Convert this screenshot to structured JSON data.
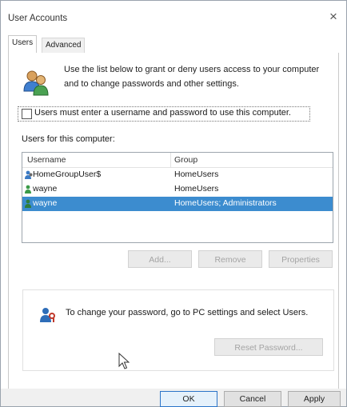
{
  "window": {
    "title": "User Accounts",
    "close_glyph": "×"
  },
  "tabs": [
    {
      "label": "Users",
      "active": true
    },
    {
      "label": "Advanced",
      "active": false
    }
  ],
  "intro": {
    "icon": "users-icon",
    "text": "Use the list below to grant or deny users access to your computer and to change passwords and other settings."
  },
  "require_password": {
    "label": "Users must enter a username and password to use this computer.",
    "checked": false
  },
  "users_list": {
    "caption": "Users for this computer:",
    "columns": [
      "Username",
      "Group"
    ],
    "rows": [
      {
        "username": "HomeGroupUser$",
        "group": "HomeUsers",
        "selected": false
      },
      {
        "username": "wayne",
        "group": "HomeUsers",
        "selected": false
      },
      {
        "username": "wayne",
        "group": "HomeUsers; Administrators",
        "selected": true
      }
    ]
  },
  "list_buttons": {
    "add": "Add...",
    "remove": "Remove",
    "properties": "Properties"
  },
  "password_section": {
    "icon": "user-key-icon",
    "text": "To change your password, go to PC settings and select Users.",
    "reset_button": "Reset Password..."
  },
  "dialog_buttons": {
    "ok": "OK",
    "cancel": "Cancel",
    "apply": "Apply"
  },
  "colors": {
    "selection": "#3c8ccf",
    "default_button_border": "#2b74c8"
  }
}
